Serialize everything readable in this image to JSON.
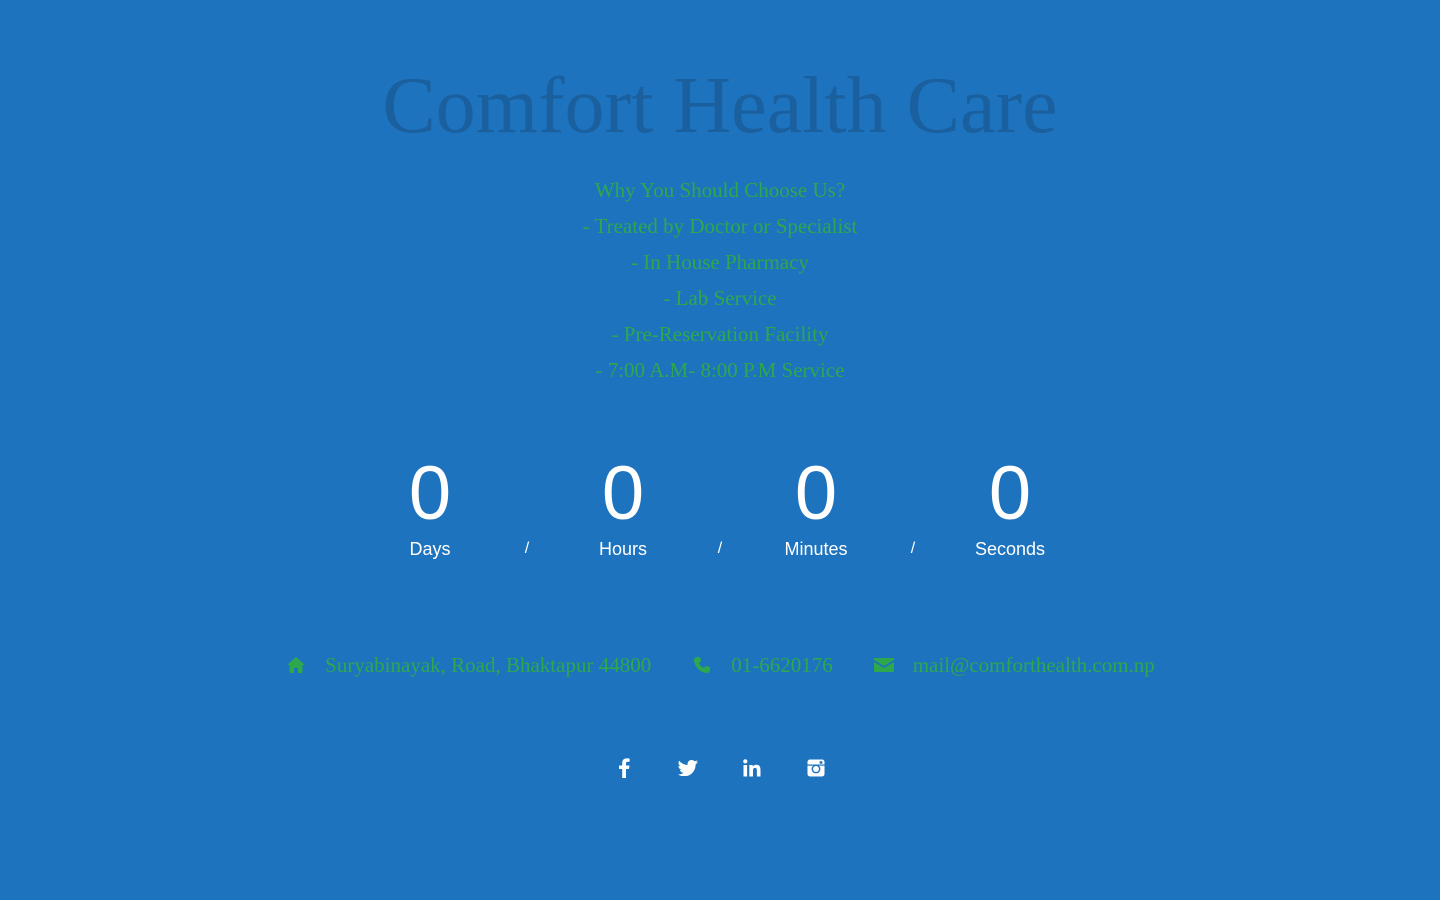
{
  "header": {
    "title": "Comfort Health Care"
  },
  "features": {
    "heading": "Why You Should Choose Us?",
    "items": [
      "- Treated by Doctor or Specialist",
      "- In House Pharmacy",
      "- Lab Service",
      "- Pre-Reservation Facility",
      "- 7:00 A.M- 8:00 P.M Service"
    ]
  },
  "countdown": {
    "days": {
      "value": "0",
      "label": "Days"
    },
    "hours": {
      "value": "0",
      "label": "Hours"
    },
    "minutes": {
      "value": "0",
      "label": "Minutes"
    },
    "seconds": {
      "value": "0",
      "label": "Seconds"
    },
    "separator": "/"
  },
  "contact": {
    "address": {
      "icon": "home-icon",
      "text": "Suryabinayak, Road, Bhaktapur 44800"
    },
    "phone": {
      "icon": "phone-icon",
      "text": "01-6620176"
    },
    "email": {
      "icon": "envelope-icon",
      "text": "mail@comforthealth.com.np"
    }
  },
  "social": {
    "icons": [
      "facebook-icon",
      "twitter-icon",
      "linkedin-icon",
      "instagram-icon"
    ]
  },
  "colors": {
    "background": "#1e73be",
    "title": "#1a5f9e",
    "accent_green": "#2ea84c",
    "countdown_text": "#ffffff",
    "social_icons": "#ffffff"
  }
}
